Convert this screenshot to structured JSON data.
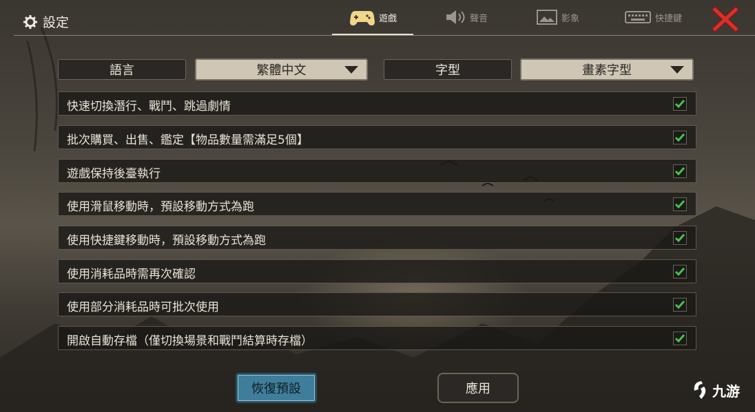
{
  "header": {
    "title": "設定",
    "tabs": [
      {
        "label": "遊戲",
        "icon": "gamepad-icon",
        "active": true
      },
      {
        "label": "聲音",
        "icon": "speaker-icon",
        "active": false
      },
      {
        "label": "影象",
        "icon": "image-icon",
        "active": false
      },
      {
        "label": "快捷鍵",
        "icon": "keyboard-icon",
        "active": false
      }
    ]
  },
  "language": {
    "label": "語言",
    "value": "繁體中文"
  },
  "font": {
    "label": "字型",
    "value": "畫素字型"
  },
  "options": [
    {
      "label": "快速切換潛行、戰鬥、跳過劇情",
      "checked": true
    },
    {
      "label": "批次購買、出售、鑑定【物品數量需滿足5個】",
      "checked": true
    },
    {
      "label": "遊戲保持後臺執行",
      "checked": true
    },
    {
      "label": "使用滑鼠移動時，預設移動方式為跑",
      "checked": true
    },
    {
      "label": "使用快捷鍵移動時，預設移動方式為跑",
      "checked": true
    },
    {
      "label": "使用消耗品時需再次確認",
      "checked": true
    },
    {
      "label": "使用部分消耗品時可批次使用",
      "checked": true
    },
    {
      "label": "開啟自動存檔（僅切換場景和戰鬥結算時存檔）",
      "checked": true
    }
  ],
  "buttons": {
    "reset": "恢復預設",
    "apply": "應用"
  },
  "watermark": {
    "text": "九游"
  },
  "colors": {
    "accent_button": "#3f7e9b",
    "checkmark": "#4cc24c",
    "close": "#d9302a"
  }
}
